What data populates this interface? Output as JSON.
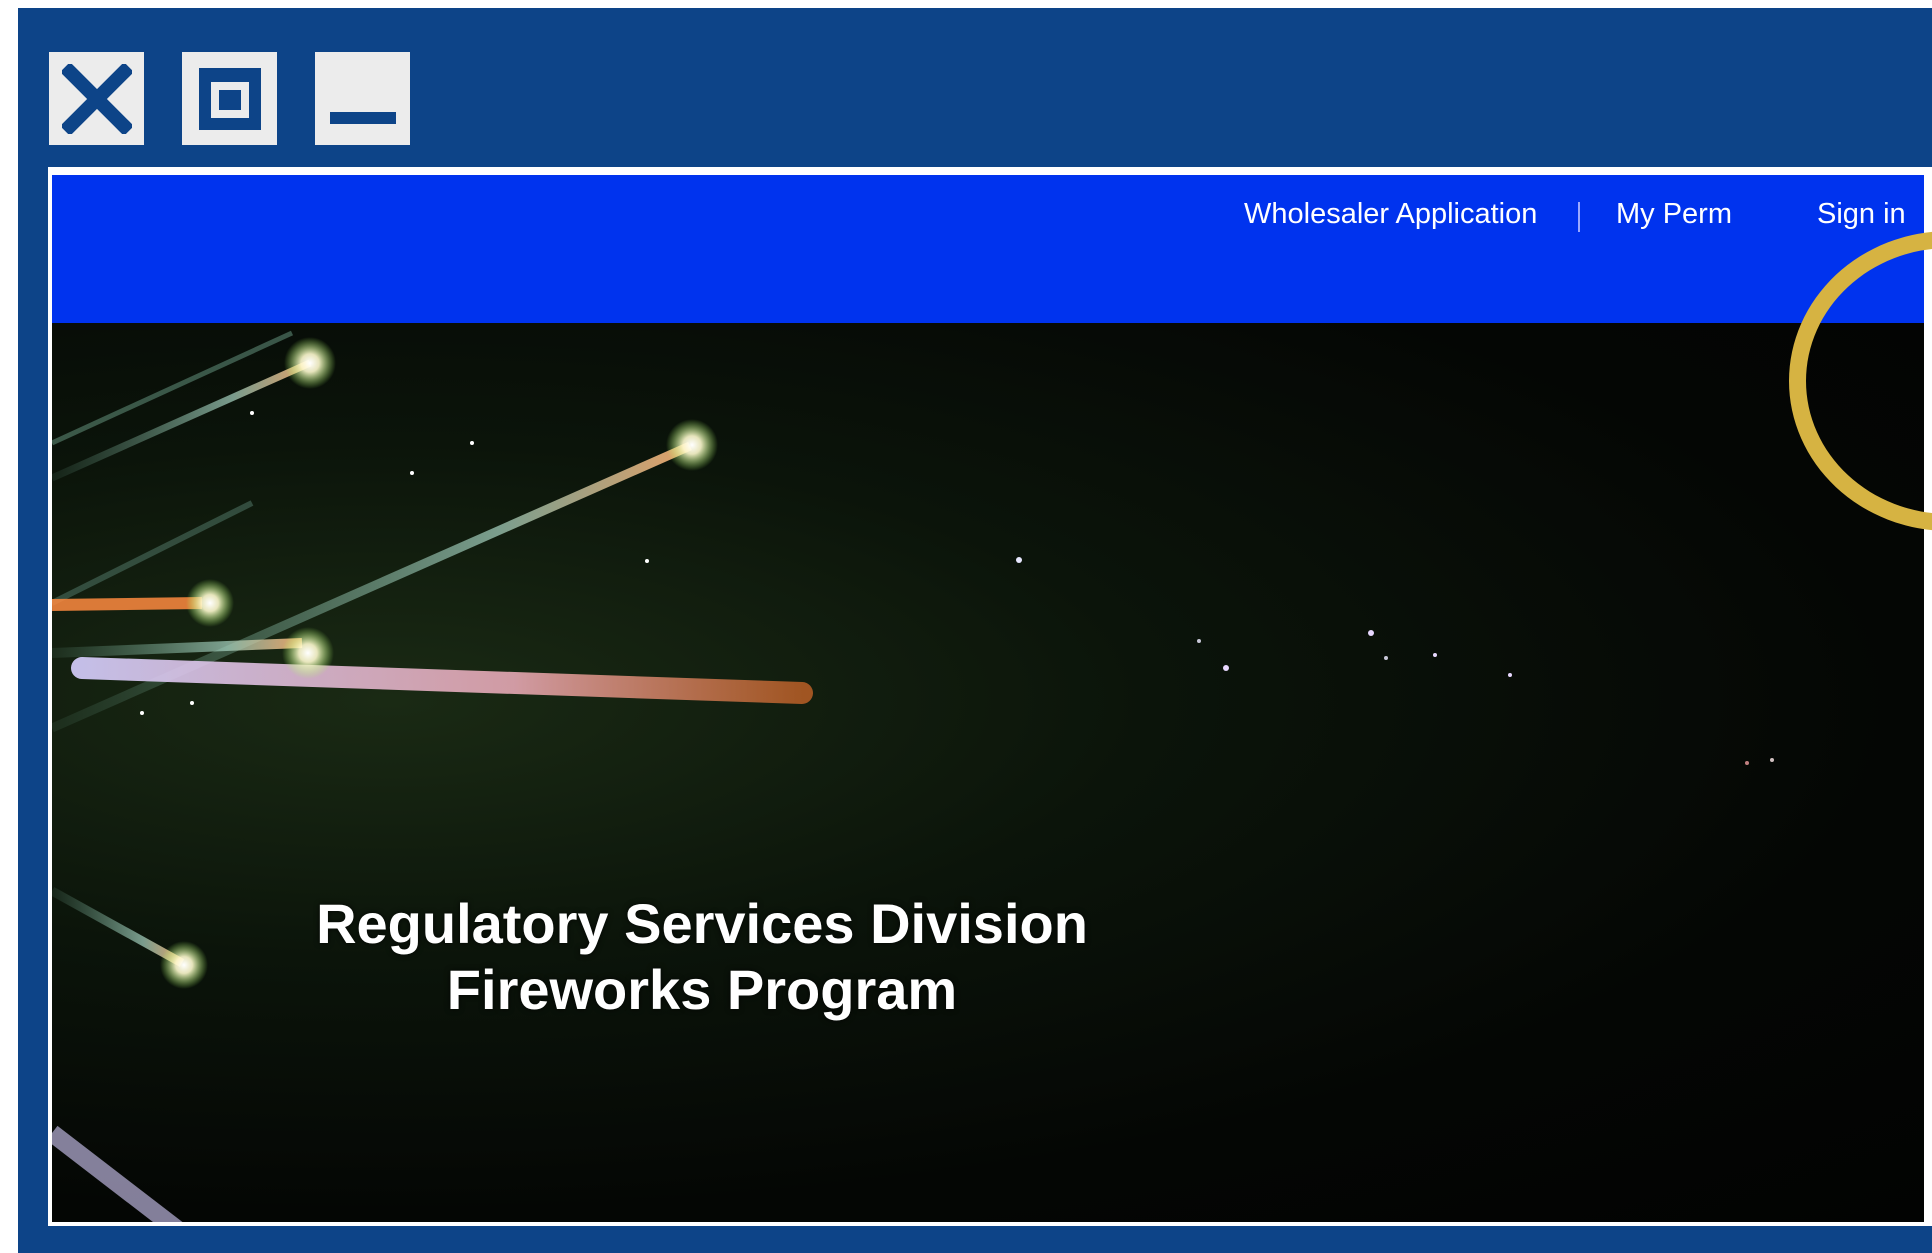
{
  "window_controls": {
    "close_icon": "close-icon",
    "maximize_icon": "maximize-icon",
    "minimize_icon": "minimize-icon"
  },
  "navbar": {
    "wholesaler_label": "Wholesaler Application",
    "permits_label": "My Perm",
    "signin_label": "Sign in",
    "bg_color": "#0033ee"
  },
  "hero": {
    "line1": "Regulatory Services Division",
    "line2": "Fireworks Program"
  },
  "colors": {
    "frame": "#0d4488",
    "highlight": "#d6b342"
  }
}
